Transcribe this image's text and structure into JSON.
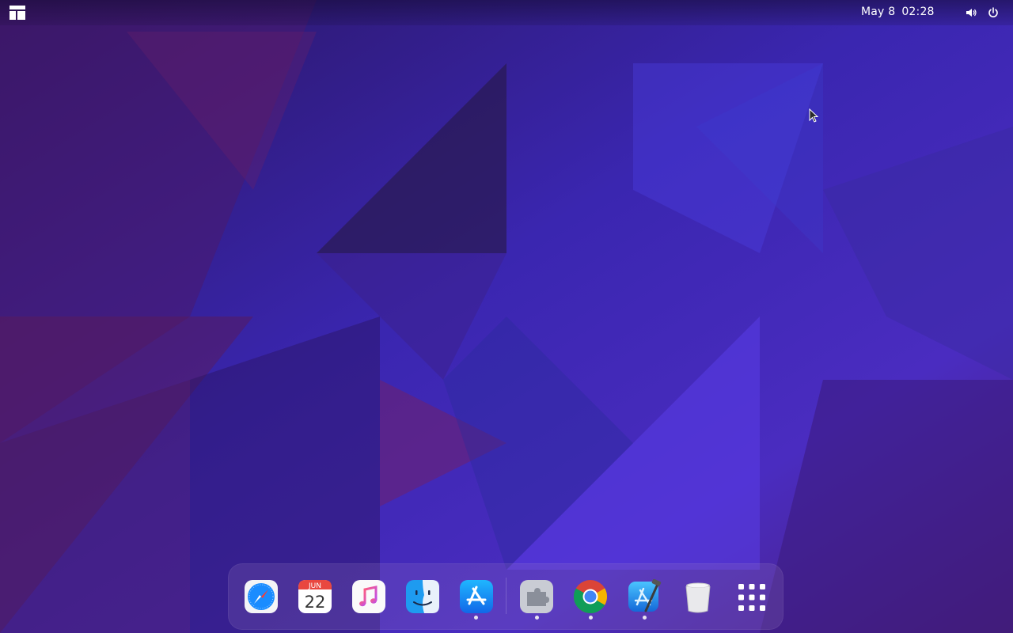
{
  "topbar": {
    "date": "May 8",
    "time": "02:28",
    "layout_icon": "window-layout-icon",
    "volume_icon": "volume-icon",
    "power_icon": "power-icon"
  },
  "dock": {
    "items": [
      {
        "name": "safari",
        "icon": "compass-icon",
        "running": false
      },
      {
        "name": "calendar",
        "icon": "calendar-icon",
        "running": false,
        "month": "JUN",
        "day": "22"
      },
      {
        "name": "music",
        "icon": "music-note-icon",
        "running": false
      },
      {
        "name": "finder",
        "icon": "finder-face-icon",
        "running": false
      },
      {
        "name": "app-store",
        "icon": "app-store-icon",
        "running": true
      },
      {
        "name": "extensions",
        "icon": "puzzle-icon",
        "running": true
      },
      {
        "name": "chrome",
        "icon": "chrome-icon",
        "running": true
      },
      {
        "name": "xcode",
        "icon": "xcode-hammer-icon",
        "running": true
      },
      {
        "name": "trash",
        "icon": "trash-icon",
        "running": false
      },
      {
        "name": "show-applications",
        "icon": "app-grid-icon",
        "running": false
      }
    ]
  },
  "colors": {
    "wallpaper_base": "#3a1f8f",
    "dock_bg": "#9678be",
    "accent_blue": "#1a8cff"
  }
}
